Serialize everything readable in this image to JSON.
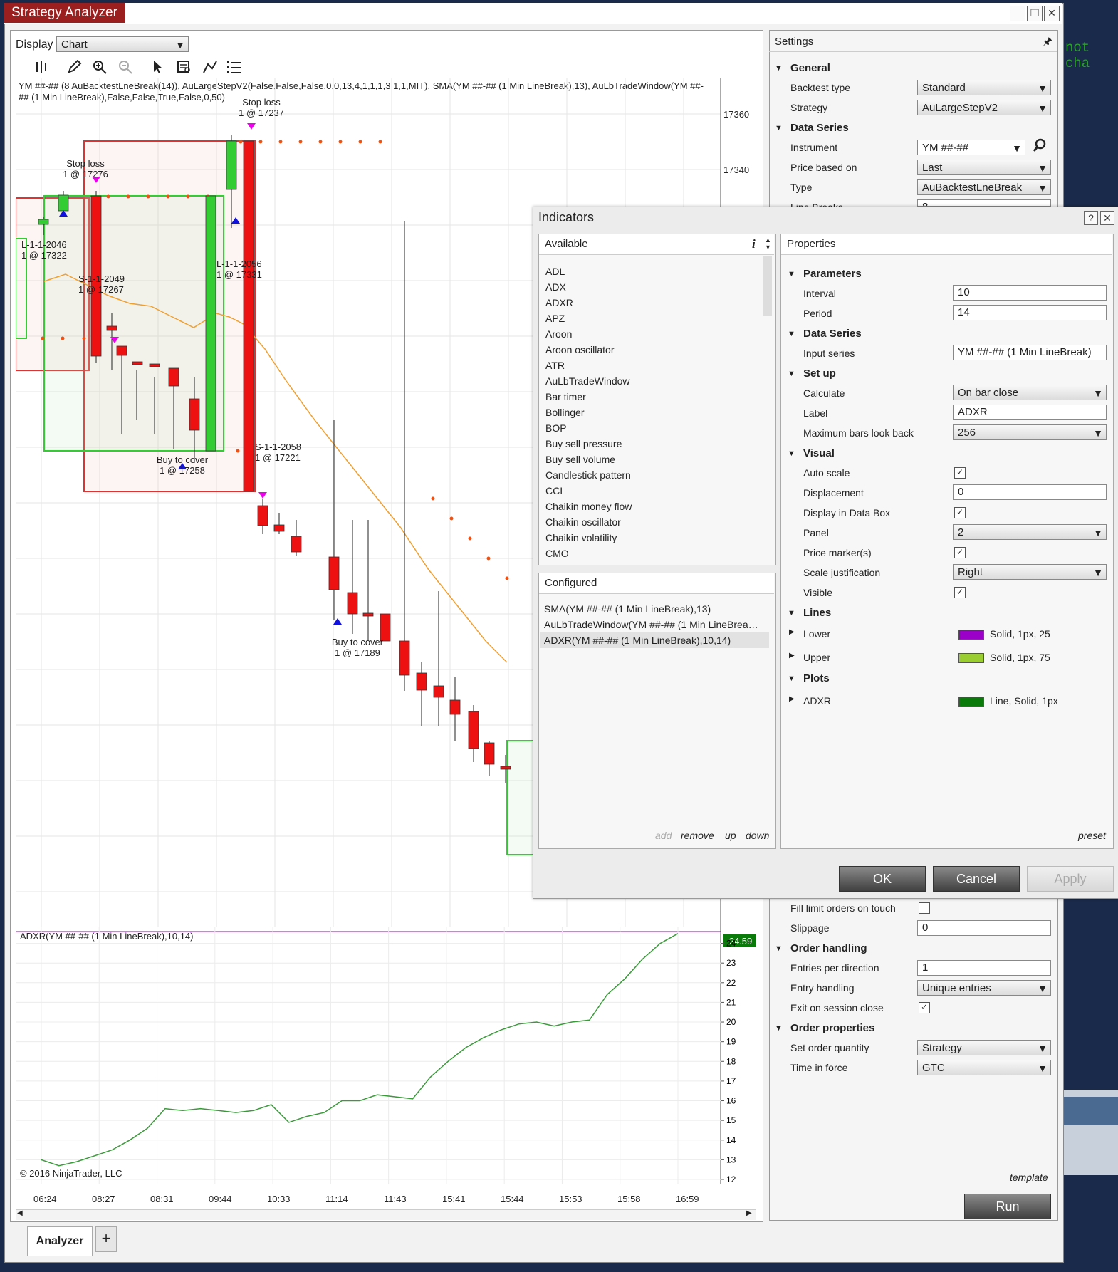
{
  "window": {
    "title": "Strategy Analyzer",
    "controls": [
      "—",
      "❐",
      "✕"
    ]
  },
  "outside": {
    "code_text": "not cha"
  },
  "display": {
    "label": "Display",
    "value": "Chart"
  },
  "chart": {
    "header_line1": "YM ##-## (8 AuBacktestLneBreak(14)), AuLargeStepV2(False,False,False,0,0,13,4,1,1,1,3,1,1,MIT), SMA(YM ##-## (1 Min LineBreak),13), AuLbTradeWindow(YM ##-",
    "header_line2": "## (1 Min LineBreak),False,False,True,False,0,50)",
    "price_ticks": [
      "17360",
      "17340"
    ],
    "annotations": [
      {
        "l1": "Stop loss",
        "l2": "1 @ 17237"
      },
      {
        "l1": "Stop loss",
        "l2": "1 @ 17276"
      },
      {
        "l1": "L-1-1-2046",
        "l2": "1 @ 17322"
      },
      {
        "l1": "S-1-1-2049",
        "l2": "1 @ 17267"
      },
      {
        "l1": "L-1-1-2056",
        "l2": "1 @ 17331"
      },
      {
        "l1": "S-1-1-2058",
        "l2": "1 @ 17221"
      },
      {
        "l1": "Buy to cover",
        "l2": "1 @ 17258"
      },
      {
        "l1": "Buy to cover",
        "l2": "1 @ 17189"
      }
    ],
    "copyright": "© 2016 NinjaTrader, LLC",
    "x_labels": [
      "06:24",
      "08:27",
      "08:31",
      "09:44",
      "10:33",
      "11:14",
      "11:43",
      "15:41",
      "15:44",
      "15:53",
      "15:58",
      "16:59"
    ]
  },
  "chart_data": {
    "type": "line",
    "title": "ADXR(YM ##-## (1 Min LineBreak),10,14)",
    "xlabel": "",
    "ylabel": "",
    "ylim": [
      12,
      24.6
    ],
    "y_ticks": [
      "24",
      "23",
      "22",
      "21",
      "20",
      "19",
      "18",
      "17",
      "16",
      "15",
      "14",
      "13",
      "12"
    ],
    "last_value_label": "24.59",
    "categories": [
      "06:24",
      "08:27",
      "08:31",
      "09:44",
      "10:33",
      "11:14",
      "11:43",
      "15:41",
      "15:44",
      "15:53",
      "15:58",
      "16:59"
    ],
    "series": [
      {
        "color": "#3a9a3a",
        "values": [
          13.0,
          12.7,
          12.9,
          13.2,
          13.5,
          14.0,
          14.6,
          15.6,
          15.5,
          15.6,
          15.5,
          15.4,
          15.5,
          15.8,
          14.9,
          15.2,
          15.4,
          16.0,
          16.0,
          16.3,
          16.2,
          16.1,
          17.2,
          18.0,
          18.7,
          19.2,
          19.6,
          19.9,
          20.0,
          19.8,
          20.0,
          20.1,
          21.4,
          22.2,
          23.2,
          24.0,
          24.5
        ]
      }
    ]
  },
  "settings": {
    "title": "Settings",
    "general": "General",
    "backtest_type_label": "Backtest type",
    "backtest_type": "Standard",
    "strategy_label": "Strategy",
    "strategy": "AuLargeStepV2",
    "data_series": "Data Series",
    "instrument_label": "Instrument",
    "instrument": "YM ##-##",
    "price_based_label": "Price based on",
    "price_based": "Last",
    "type_label": "Type",
    "type": "AuBacktestLneBreak",
    "line_breaks_label": "Line Breaks",
    "line_breaks": "8",
    "fill_limit_label": "Fill limit orders on touch",
    "slippage_label": "Slippage",
    "slippage": "0",
    "order_handling": "Order handling",
    "entries_label": "Entries per direction",
    "entries": "1",
    "entry_handling_label": "Entry handling",
    "entry_handling": "Unique entries",
    "exit_label": "Exit on session close",
    "order_props": "Order properties",
    "set_qty_label": "Set order quantity",
    "set_qty": "Strategy",
    "tif_label": "Time in force",
    "tif": "GTC",
    "template": "template",
    "run": "Run"
  },
  "indicators": {
    "title": "Indicators",
    "help": "?",
    "close": "✕",
    "available_label": "Available",
    "available": [
      "ADL",
      "ADX",
      "ADXR",
      "APZ",
      "Aroon",
      "Aroon oscillator",
      "ATR",
      "AuLbTradeWindow",
      "Bar timer",
      "Bollinger",
      "BOP",
      "Buy sell pressure",
      "Buy sell volume",
      "Candlestick pattern",
      "CCI",
      "Chaikin money flow",
      "Chaikin oscillator",
      "Chaikin volatility",
      "CMO"
    ],
    "configured_label": "Configured",
    "configured": [
      "SMA(YM ##-## (1 Min LineBreak),13)",
      "AuLbTradeWindow(YM ##-## (1 Min LineBrea…",
      "ADXR(YM ##-## (1 Min LineBreak),10,14)"
    ],
    "actions": {
      "add": "add",
      "remove": "remove",
      "up": "up",
      "down": "down"
    },
    "properties_label": "Properties",
    "parameters": "Parameters",
    "interval_label": "Interval",
    "interval": "10",
    "period_label": "Period",
    "period": "14",
    "data_series": "Data Series",
    "input_series_label": "Input series",
    "input_series": "YM ##-## (1 Min LineBreak)",
    "setup": "Set up",
    "calculate_label": "Calculate",
    "calculate": "On bar close",
    "label_label": "Label",
    "label": "ADXR",
    "max_bars_label": "Maximum bars look back",
    "max_bars": "256",
    "visual": "Visual",
    "auto_scale_label": "Auto scale",
    "displacement_label": "Displacement",
    "displacement": "0",
    "display_db_label": "Display in Data Box",
    "panel_label": "Panel",
    "panel": "2",
    "price_marker_label": "Price marker(s)",
    "scale_just_label": "Scale justification",
    "scale_just": "Right",
    "visible_label": "Visible",
    "lines": "Lines",
    "lower_label": "Lower",
    "lower_value": "Solid, 1px, 25",
    "lower_color": "#9b00c8",
    "upper_label": "Upper",
    "upper_value": "Solid, 1px, 75",
    "upper_color": "#9acd32",
    "plots": "Plots",
    "adxr_label": "ADXR",
    "adxr_value": "Line, Solid, 1px",
    "adxr_color": "#0a7a0a",
    "preset": "preset",
    "ok": "OK",
    "cancel": "Cancel",
    "apply": "Apply"
  },
  "tabs": {
    "analyzer": "Analyzer",
    "add": "+"
  }
}
